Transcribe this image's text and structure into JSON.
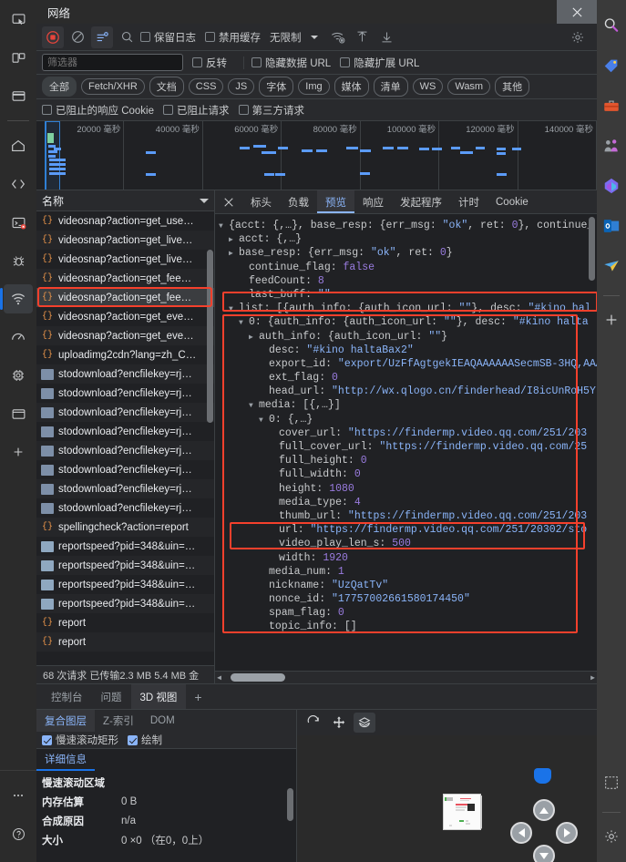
{
  "window": {
    "title": "网络",
    "close_label": "✕"
  },
  "left_rail": {
    "items": [
      {
        "name": "inspect-cursor-icon"
      },
      {
        "name": "device-toggle-icon"
      },
      {
        "name": "panel-layout-icon"
      },
      {
        "name": "home-icon"
      },
      {
        "name": "code-elements-icon"
      },
      {
        "name": "console-icon"
      },
      {
        "name": "bug-issues-icon"
      },
      {
        "name": "network-icon"
      },
      {
        "name": "performance-gauge-icon"
      },
      {
        "name": "memory-chip-icon"
      },
      {
        "name": "application-window-icon"
      },
      {
        "name": "add-tab-icon"
      }
    ],
    "bottom": [
      {
        "name": "more-options-icon"
      },
      {
        "name": "help-icon"
      }
    ]
  },
  "right_rail": {
    "items": [
      {
        "name": "search-magnifier-icon"
      },
      {
        "name": "price-tag-icon"
      },
      {
        "name": "toolbox-icon"
      },
      {
        "name": "people-icon"
      },
      {
        "name": "office-icon"
      },
      {
        "name": "outlook-icon"
      },
      {
        "name": "telegram-send-icon"
      },
      {
        "name": "add-icon"
      }
    ],
    "bottom": [
      {
        "name": "screenshot-snip-icon"
      },
      {
        "name": "settings-gear-icon"
      }
    ]
  },
  "toolbar": {
    "record_label": "record-stop-button",
    "clear_label": "clear-button",
    "filter_toggle_label": "filter-toggle-button",
    "search_label": "search-button",
    "preserve_log": "保留日志",
    "disable_cache": "禁用缓存",
    "throttle_value": "无限制",
    "wifi_label": "network-conditions-button",
    "import_label": "import-har-button",
    "export_label": "export-har-button",
    "settings_label": "settings-button"
  },
  "filterbar": {
    "input_value": "",
    "input_placeholder": "筛选器",
    "invert": "反转",
    "hide_data_url": "隐藏数据 URL",
    "hide_ext_url": "隐藏扩展 URL"
  },
  "types": [
    {
      "label": "全部",
      "selected": true,
      "outlined": false
    },
    {
      "label": "Fetch/XHR",
      "selected": false,
      "outlined": true
    },
    {
      "label": "文档",
      "selected": false,
      "outlined": true
    },
    {
      "label": "CSS",
      "selected": false,
      "outlined": true
    },
    {
      "label": "JS",
      "selected": false,
      "outlined": true
    },
    {
      "label": "字体",
      "selected": false,
      "outlined": true
    },
    {
      "label": "Img",
      "selected": false,
      "outlined": true
    },
    {
      "label": "媒体",
      "selected": false,
      "outlined": true
    },
    {
      "label": "清单",
      "selected": false,
      "outlined": true
    },
    {
      "label": "WS",
      "selected": false,
      "outlined": true
    },
    {
      "label": "Wasm",
      "selected": false,
      "outlined": true
    },
    {
      "label": "其他",
      "selected": false,
      "outlined": true
    }
  ],
  "blockopts": [
    {
      "label": "已阻止的响应 Cookie"
    },
    {
      "label": "已阻止请求"
    },
    {
      "label": "第三方请求"
    }
  ],
  "overview": {
    "ticks": [
      "20000 毫秒",
      "40000 毫秒",
      "60000 毫秒",
      "80000 毫秒",
      "100000 毫秒",
      "120000 毫秒",
      "140000 毫秒"
    ],
    "unit": "毫秒"
  },
  "requests": {
    "column_header": "名称",
    "rows": [
      {
        "name": "videosnap?action=get_use…",
        "icon": "json-icon",
        "selected": false
      },
      {
        "name": "videosnap?action=get_live…",
        "icon": "json-icon",
        "selected": false
      },
      {
        "name": "videosnap?action=get_live…",
        "icon": "json-icon",
        "selected": false
      },
      {
        "name": "videosnap?action=get_fee…",
        "icon": "json-icon",
        "selected": false
      },
      {
        "name": "videosnap?action=get_fee…",
        "icon": "json-icon",
        "selected": true
      },
      {
        "name": "videosnap?action=get_eve…",
        "icon": "json-icon",
        "selected": false
      },
      {
        "name": "videosnap?action=get_eve…",
        "icon": "json-icon",
        "selected": false
      },
      {
        "name": "uploadimg2cdn?lang=zh_C…",
        "icon": "json-icon",
        "selected": false
      },
      {
        "name": "stodownload?encfilekey=rj…",
        "icon": "image-icon",
        "selected": false
      },
      {
        "name": "stodownload?encfilekey=rj…",
        "icon": "image-icon",
        "selected": false
      },
      {
        "name": "stodownload?encfilekey=rj…",
        "icon": "image-icon",
        "selected": false
      },
      {
        "name": "stodownload?encfilekey=rj…",
        "icon": "image-icon",
        "selected": false
      },
      {
        "name": "stodownload?encfilekey=rj…",
        "icon": "image-icon",
        "selected": false
      },
      {
        "name": "stodownload?encfilekey=rj…",
        "icon": "image-icon",
        "selected": false
      },
      {
        "name": "stodownload?encfilekey=rj…",
        "icon": "image-icon",
        "selected": false
      },
      {
        "name": "stodownload?encfilekey=rj…",
        "icon": "image-icon",
        "selected": false
      },
      {
        "name": "spellingcheck?action=report",
        "icon": "json-icon",
        "selected": false
      },
      {
        "name": "reportspeed?pid=348&uin=…",
        "icon": "doc-icon",
        "selected": false
      },
      {
        "name": "reportspeed?pid=348&uin=…",
        "icon": "doc-icon",
        "selected": false
      },
      {
        "name": "reportspeed?pid=348&uin=…",
        "icon": "doc-icon",
        "selected": false
      },
      {
        "name": "reportspeed?pid=348&uin=…",
        "icon": "doc-icon",
        "selected": false
      },
      {
        "name": "report",
        "icon": "json-icon",
        "selected": false
      },
      {
        "name": "report",
        "icon": "json-icon",
        "selected": false
      }
    ],
    "status": "68 次请求  已传输2.3 MB  5.4 MB 金"
  },
  "detail_tabs": [
    {
      "label": "标头",
      "selected": false
    },
    {
      "label": "负载",
      "selected": false
    },
    {
      "label": "预览",
      "selected": true
    },
    {
      "label": "响应",
      "selected": false
    },
    {
      "label": "发起程序",
      "selected": false
    },
    {
      "label": "计时",
      "selected": false
    },
    {
      "label": "Cookie",
      "selected": false
    }
  ],
  "preview_lines": [
    {
      "indent": 0,
      "tri": "open",
      "parts": [
        {
          "t": "{acct: {,…}, base_resp: {err_msg: ",
          "c": "k"
        },
        {
          "t": "\"ok\"",
          "c": "s"
        },
        {
          "t": ", ret: ",
          "c": "k"
        },
        {
          "t": "0",
          "c": "n"
        },
        {
          "t": "}, continue_",
          "c": "k"
        }
      ]
    },
    {
      "indent": 1,
      "tri": "closed",
      "parts": [
        {
          "t": "acct: {,…}",
          "c": "k"
        }
      ]
    },
    {
      "indent": 1,
      "tri": "closed",
      "parts": [
        {
          "t": "base_resp: {err_msg: ",
          "c": "k"
        },
        {
          "t": "\"ok\"",
          "c": "s"
        },
        {
          "t": ", ret: ",
          "c": "k"
        },
        {
          "t": "0",
          "c": "n"
        },
        {
          "t": "}",
          "c": "k"
        }
      ]
    },
    {
      "indent": 2,
      "tri": "none",
      "parts": [
        {
          "t": "continue_flag: ",
          "c": "k"
        },
        {
          "t": "false",
          "c": "b"
        }
      ]
    },
    {
      "indent": 2,
      "tri": "none",
      "parts": [
        {
          "t": "feedCount: ",
          "c": "k"
        },
        {
          "t": "8",
          "c": "n"
        }
      ]
    },
    {
      "indent": 2,
      "tri": "none",
      "parts": [
        {
          "t": "last_buff: ",
          "c": "k"
        },
        {
          "t": "\"\"",
          "c": "s"
        }
      ]
    },
    {
      "indent": 1,
      "tri": "open",
      "parts": [
        {
          "t": "list: [{auth_info: {auth_icon_url: ",
          "c": "k"
        },
        {
          "t": "\"\"",
          "c": "s"
        },
        {
          "t": "}, desc: ",
          "c": "k"
        },
        {
          "t": "\"#kino hal",
          "c": "s"
        }
      ]
    },
    {
      "indent": 2,
      "tri": "open",
      "parts": [
        {
          "t": "0: {auth_info: {auth_icon_url: ",
          "c": "k"
        },
        {
          "t": "\"\"",
          "c": "s"
        },
        {
          "t": "}, desc: ",
          "c": "k"
        },
        {
          "t": "\"#kino halta",
          "c": "s"
        }
      ]
    },
    {
      "indent": 3,
      "tri": "closed",
      "parts": [
        {
          "t": "auth_info: {auth_icon_url: ",
          "c": "k"
        },
        {
          "t": "\"\"",
          "c": "s"
        },
        {
          "t": "}",
          "c": "k"
        }
      ]
    },
    {
      "indent": 4,
      "tri": "none",
      "parts": [
        {
          "t": "desc: ",
          "c": "k"
        },
        {
          "t": "\"#kino haltaBax2\"",
          "c": "s"
        }
      ]
    },
    {
      "indent": 4,
      "tri": "none",
      "parts": [
        {
          "t": "export_id: ",
          "c": "k"
        },
        {
          "t": "\"export/UzFfAgtgekIEAQAAAAAASecmSB-3HQ,AAA",
          "c": "s"
        }
      ]
    },
    {
      "indent": 4,
      "tri": "none",
      "parts": [
        {
          "t": "ext_flag: ",
          "c": "k"
        },
        {
          "t": "0",
          "c": "n"
        }
      ]
    },
    {
      "indent": 4,
      "tri": "none",
      "parts": [
        {
          "t": "head_url: ",
          "c": "k"
        },
        {
          "t": "\"http://wx.qlogo.cn/finderhead/I8icUnRoH5Y",
          "c": "s"
        }
      ]
    },
    {
      "indent": 3,
      "tri": "open",
      "parts": [
        {
          "t": "media: [{,…}]",
          "c": "k"
        }
      ]
    },
    {
      "indent": 4,
      "tri": "open",
      "parts": [
        {
          "t": "0: {,…}",
          "c": "k"
        }
      ]
    },
    {
      "indent": 5,
      "tri": "none",
      "parts": [
        {
          "t": "cover_url: ",
          "c": "k"
        },
        {
          "t": "\"https://findermp.video.qq.com/251/203",
          "c": "s"
        }
      ]
    },
    {
      "indent": 5,
      "tri": "none",
      "parts": [
        {
          "t": "full_cover_url: ",
          "c": "k"
        },
        {
          "t": "\"https://findermp.video.qq.com/25",
          "c": "s"
        }
      ]
    },
    {
      "indent": 5,
      "tri": "none",
      "parts": [
        {
          "t": "full_height: ",
          "c": "k"
        },
        {
          "t": "0",
          "c": "n"
        }
      ]
    },
    {
      "indent": 5,
      "tri": "none",
      "parts": [
        {
          "t": "full_width: ",
          "c": "k"
        },
        {
          "t": "0",
          "c": "n"
        }
      ]
    },
    {
      "indent": 5,
      "tri": "none",
      "parts": [
        {
          "t": "height: ",
          "c": "k"
        },
        {
          "t": "1080",
          "c": "n"
        }
      ]
    },
    {
      "indent": 5,
      "tri": "none",
      "parts": [
        {
          "t": "media_type: ",
          "c": "k"
        },
        {
          "t": "4",
          "c": "n"
        }
      ]
    },
    {
      "indent": 5,
      "tri": "none",
      "parts": [
        {
          "t": "thumb_url: ",
          "c": "k"
        },
        {
          "t": "\"https://findermp.video.qq.com/251/203",
          "c": "s"
        }
      ]
    },
    {
      "indent": 5,
      "tri": "none",
      "parts": [
        {
          "t": "url: ",
          "c": "k"
        },
        {
          "t": "\"https://findermp.video.qq.com/251/20302/sto",
          "c": "s"
        }
      ]
    },
    {
      "indent": 5,
      "tri": "none",
      "parts": [
        {
          "t": "video_play_len_s: ",
          "c": "k"
        },
        {
          "t": "500",
          "c": "n"
        }
      ]
    },
    {
      "indent": 5,
      "tri": "none",
      "parts": [
        {
          "t": "width: ",
          "c": "k"
        },
        {
          "t": "1920",
          "c": "n"
        }
      ]
    },
    {
      "indent": 4,
      "tri": "none",
      "parts": [
        {
          "t": "media_num: ",
          "c": "k"
        },
        {
          "t": "1",
          "c": "n"
        }
      ]
    },
    {
      "indent": 4,
      "tri": "none",
      "parts": [
        {
          "t": "nickname: ",
          "c": "k"
        },
        {
          "t": "\"UzQatTv\"",
          "c": "s"
        }
      ]
    },
    {
      "indent": 4,
      "tri": "none",
      "parts": [
        {
          "t": "nonce_id: ",
          "c": "k"
        },
        {
          "t": "\"17757002661580174450\"",
          "c": "s"
        }
      ]
    },
    {
      "indent": 4,
      "tri": "none",
      "parts": [
        {
          "t": "spam_flag: ",
          "c": "k"
        },
        {
          "t": "0",
          "c": "n"
        }
      ]
    },
    {
      "indent": 4,
      "tri": "none",
      "parts": [
        {
          "t": "topic_info: []",
          "c": "k"
        }
      ]
    }
  ],
  "drawer": {
    "tabs": [
      {
        "label": "控制台",
        "selected": false
      },
      {
        "label": "问题",
        "selected": false
      },
      {
        "label": "3D 视图",
        "selected": true
      }
    ],
    "add_label": "+",
    "sub_tabs": [
      {
        "label": "复合图层",
        "selected": true
      },
      {
        "label": "Z-索引",
        "selected": false
      },
      {
        "label": "DOM",
        "selected": false
      }
    ],
    "options": [
      {
        "label": "慢速滚动矩形",
        "checked": true
      },
      {
        "label": "绘制",
        "checked": true
      }
    ],
    "detail_tab": "详细信息",
    "detail_rows": [
      {
        "key": "大小",
        "value": "0 ×0 （在0，0上）"
      },
      {
        "key": "合成原因",
        "value": "n/a"
      },
      {
        "key": "内存估算",
        "value": "0 B"
      },
      {
        "key": "慢速滚动区域",
        "value": ""
      }
    ],
    "canvas_tools": [
      {
        "name": "reset-view-button",
        "active": false
      },
      {
        "name": "pan-move-button",
        "active": false
      },
      {
        "name": "rotate-layers-button",
        "active": true
      }
    ],
    "nav_buttons": [
      {
        "name": "pan-up-button"
      },
      {
        "name": "pan-left-button"
      },
      {
        "name": "pan-right-button"
      },
      {
        "name": "pan-down-button"
      }
    ]
  },
  "colors": {
    "accent": "#8ab4f8",
    "highlight_box": "#f5402c",
    "record_active": "#e8453c",
    "bar": "#5b9bf8",
    "bg": "#202124",
    "panel": "#292a2d"
  }
}
